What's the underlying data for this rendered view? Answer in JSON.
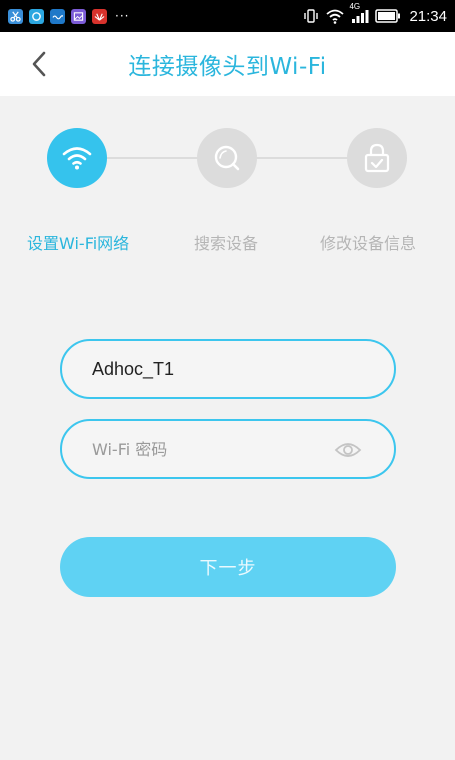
{
  "status_bar": {
    "notification_icons": [
      "scissors-app-icon",
      "circle-app-icon",
      "wave-app-icon",
      "gallery-app-icon",
      "huawei-app-icon"
    ],
    "overflow": "···",
    "network": "4G",
    "time": "21:34"
  },
  "header": {
    "title": "连接摄像头到Wi-Fi",
    "back_icon": "chevron-left-icon"
  },
  "steps": [
    {
      "label": "设置Wi-Fi网络",
      "icon": "wifi-icon",
      "active": true
    },
    {
      "label": "搜索设备",
      "icon": "search-icon",
      "active": false
    },
    {
      "label": "修改设备信息",
      "icon": "lock-check-icon",
      "active": false
    }
  ],
  "form": {
    "ssid_value": "Adhoc_T1",
    "password_placeholder": "Wi-Fi 密码",
    "password_value": ""
  },
  "next_button": {
    "label": "下一步"
  },
  "colors": {
    "accent": "#2bb6dd",
    "step_active": "#35c3ed",
    "step_inactive": "#dcdcdc",
    "field_border": "#3cc6ee",
    "button_bg": "#5fd2f3",
    "background": "#f2f2f2"
  }
}
